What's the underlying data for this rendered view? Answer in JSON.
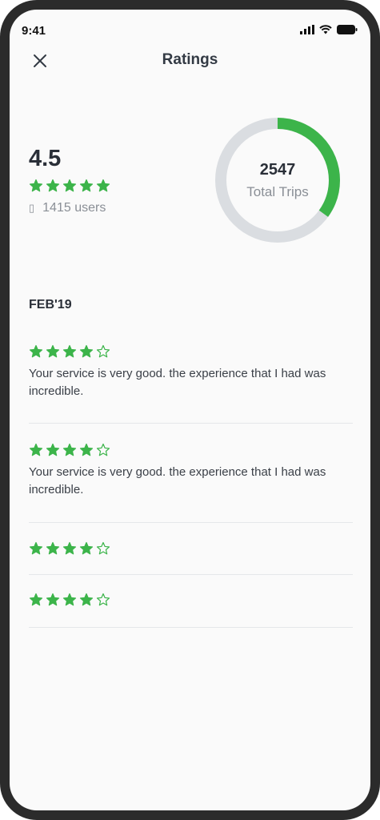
{
  "status_bar": {
    "time": "9:41"
  },
  "header": {
    "title": "Ratings"
  },
  "summary": {
    "rating": "4.5",
    "stars_filled": 5,
    "users_text": "1415 users",
    "total_trips": "2547",
    "total_trips_label": "Total Trips",
    "ring_fraction": 0.35
  },
  "month_label": "FEB'19",
  "reviews": [
    {
      "stars": 4,
      "max": 5,
      "text": "Your service is very good. the experience that I had was incredible."
    },
    {
      "stars": 4,
      "max": 5,
      "text": "Your service is very good. the experience that I had was incredible."
    },
    {
      "stars": 4,
      "max": 5,
      "text": ""
    },
    {
      "stars": 4,
      "max": 5,
      "text": ""
    }
  ],
  "colors": {
    "accent": "#3cb44a",
    "ring_bg": "#dadde1",
    "text_dark": "#2a2f38",
    "text_muted": "#8a8f96"
  },
  "icons": {
    "close": "close-icon",
    "star": "star-icon",
    "signal": "signal-icon",
    "wifi": "wifi-icon",
    "battery": "battery-icon"
  }
}
